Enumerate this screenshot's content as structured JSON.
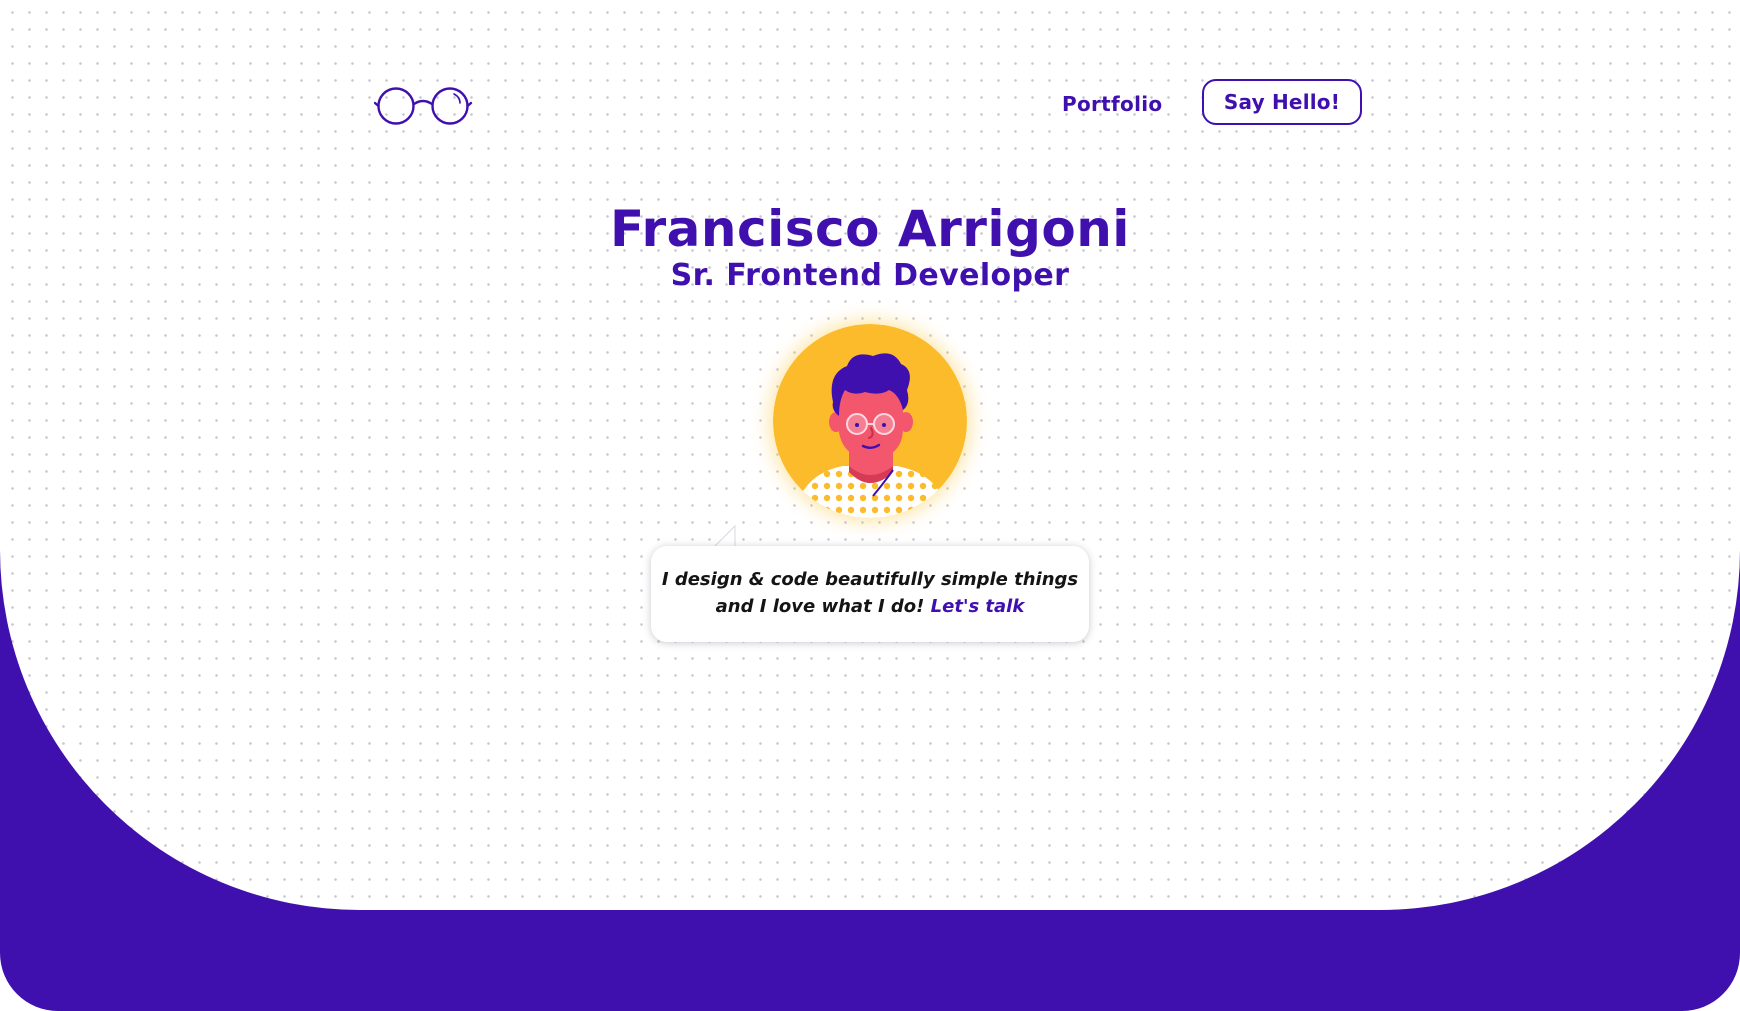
{
  "brand": {
    "logo_icon": "glasses-icon",
    "primary_color": "#3f10ae",
    "accent_color": "#fcbb2b"
  },
  "nav": {
    "portfolio_label": "Portfolio",
    "cta_label": "Say Hello!"
  },
  "hero": {
    "name": "Francisco Arrigoni",
    "role": "Sr. Frontend Developer",
    "avatar_icon": "developer-avatar-illustration",
    "bubble": {
      "line1": "I design & code beautifully simple things",
      "line2": "and I love what I do!",
      "link_label": "Let's talk"
    }
  }
}
